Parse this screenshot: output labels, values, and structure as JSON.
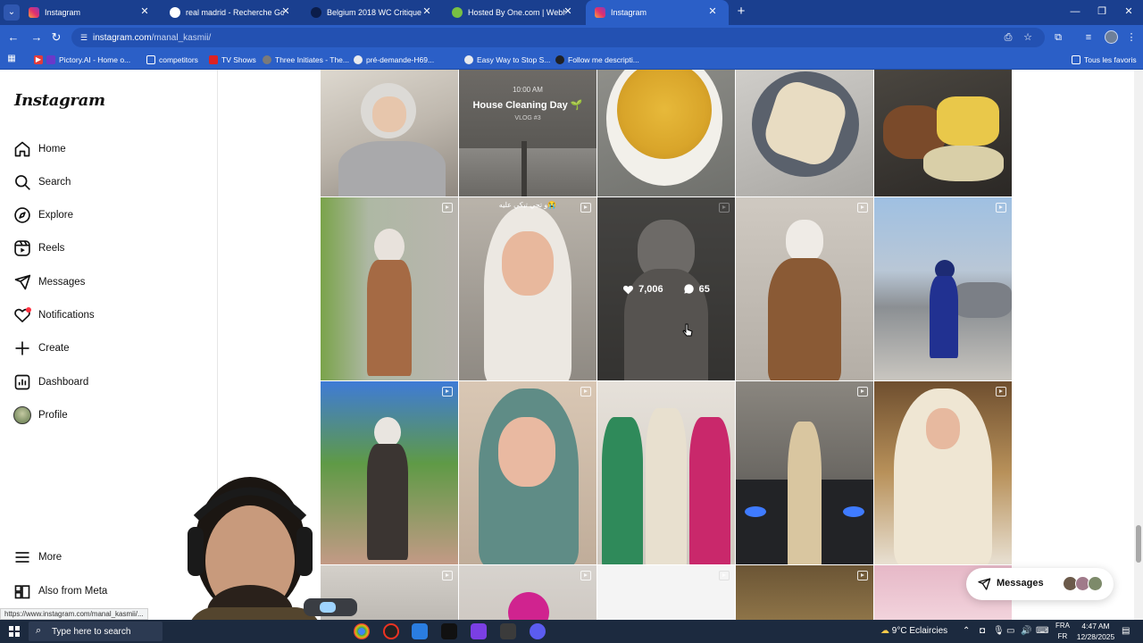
{
  "browser": {
    "tabs": [
      {
        "title": "Instagram",
        "favicon": "instagram-icon",
        "active": false
      },
      {
        "title": "real madrid - Recherche Google",
        "favicon": "google-icon",
        "active": false
      },
      {
        "title": "Belgium 2018 WC Critique",
        "favicon": "site-icon",
        "active": false
      },
      {
        "title": "Hosted By One.com | Webhosting",
        "favicon": "onecom-icon",
        "active": false
      },
      {
        "title": "Instagram",
        "favicon": "instagram-icon",
        "active": true
      }
    ],
    "url_main": "instagram.com",
    "url_path": "/manal_kasmii/",
    "bookmarks": [
      {
        "label": "Pictory.AI - Home o...",
        "color": "#e23b3b"
      },
      {
        "label": "competitors",
        "color": "#f0c050"
      },
      {
        "label": "TV Shows",
        "color": "#d22"
      },
      {
        "label": "Three Initiates - The...",
        "color": "#7a7a7a"
      },
      {
        "label": "pré-demande-H69...",
        "color": "#5f6368"
      },
      {
        "label": "Easy Way to Stop S...",
        "color": "#5f6368"
      },
      {
        "label": "Follow me descripti...",
        "color": "#202124"
      }
    ],
    "all_bookmarks": "Tous les favoris",
    "status_url": "https://www.instagram.com/manal_kasmii/..."
  },
  "instagram": {
    "logo": "Instagram",
    "nav": [
      {
        "label": "Home",
        "icon": "home-icon"
      },
      {
        "label": "Search",
        "icon": "search-icon"
      },
      {
        "label": "Explore",
        "icon": "compass-icon"
      },
      {
        "label": "Reels",
        "icon": "reels-icon"
      },
      {
        "label": "Messages",
        "icon": "paper-plane-icon"
      },
      {
        "label": "Notifications",
        "icon": "heart-icon"
      },
      {
        "label": "Create",
        "icon": "plus-icon"
      },
      {
        "label": "Dashboard",
        "icon": "dashboard-icon"
      },
      {
        "label": "Profile",
        "icon": "avatar"
      }
    ],
    "more": "More",
    "also_from_meta": "Also from Meta",
    "hovered_post": {
      "likes": "7,006",
      "comments": "65"
    },
    "post_captions": {
      "house_time": "10:00 AM",
      "house_title": "House Cleaning Day 🌱",
      "house_sub": "VLOG #3",
      "arabic": "و تجي تبكي عليه😭"
    },
    "messages_bubble": "Messages"
  },
  "taskbar": {
    "search_placeholder": "Type here to search",
    "weather": "9°C  Eclaircies",
    "lang_top": "FRA",
    "lang_bottom": "FR",
    "time": "4:47 AM",
    "date": "12/28/2025"
  },
  "colors": {
    "accent": "#2b5fc7",
    "tabstrip": "#1a3f8f",
    "notif": "#ff3040"
  }
}
